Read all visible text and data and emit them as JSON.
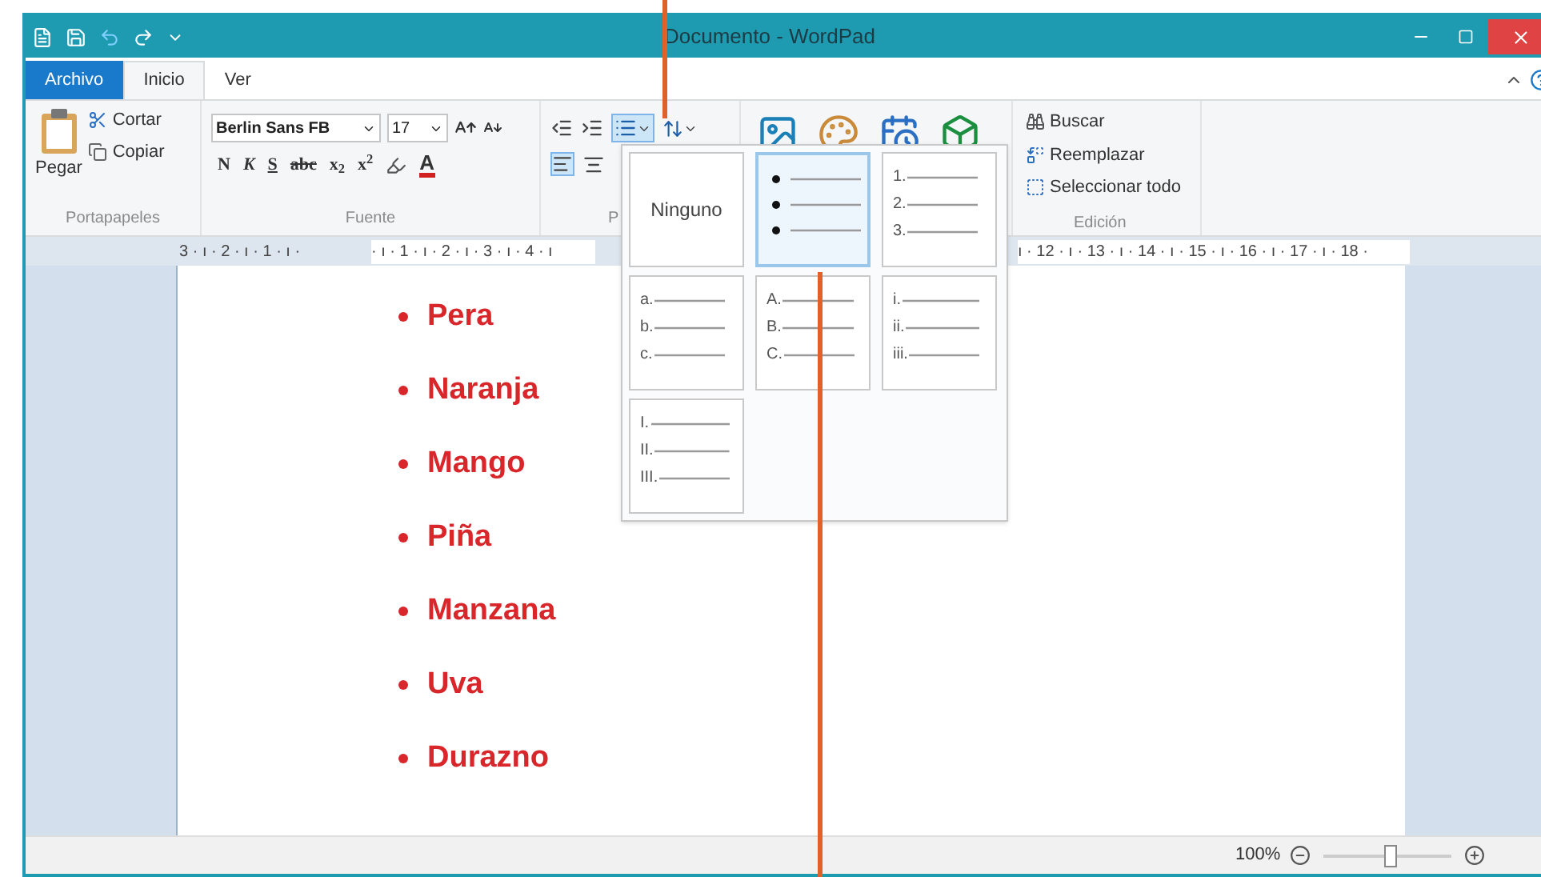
{
  "window": {
    "title": "Documento - WordPad"
  },
  "tabs": [
    {
      "label": "Archivo",
      "kind": "file",
      "selected": false
    },
    {
      "label": "Inicio",
      "kind": "tab",
      "selected": true
    },
    {
      "label": "Ver",
      "kind": "tab",
      "selected": false
    }
  ],
  "clipboard": {
    "paste": "Pegar",
    "cut": "Cortar",
    "copy": "Copiar",
    "label": "Portapapeles"
  },
  "font": {
    "name": "Berlin Sans FB",
    "size": "17",
    "format_buttons": [
      "N",
      "K",
      "S",
      "abc",
      "x$_{2}$",
      "x$^{2}$"
    ],
    "font_color": "A",
    "label": "Fuente"
  },
  "paragraph": {
    "label": "P"
  },
  "editing": {
    "find": "Buscar",
    "replace": "Reemplazar",
    "select_all": "Seleccionar todo",
    "label": "Edición"
  },
  "ruler": {
    "left": "3 · ı · 2 · ı · 1 · ı ·",
    "middle": "· ı · 1 · ı · 2 · ı · 3 · ı · 4 · ı",
    "right": "ı · 12 · ı · 13 · ı · 14 · ı · 15 · ı · 16 · ı · 17 · ı · 18 ·"
  },
  "document": {
    "items": [
      "Pera",
      "Naranja",
      "Mango",
      "Piña",
      "Manzana",
      "Uva",
      "Durazno"
    ]
  },
  "list_menu": {
    "options": [
      {
        "kind": "none",
        "label": "Ninguno",
        "selected": false
      },
      {
        "kind": "bullet",
        "selected": true
      },
      {
        "kind": "marked",
        "markers": [
          "1.",
          "2.",
          "3."
        ],
        "selected": false
      },
      {
        "kind": "marked",
        "markers": [
          "a.",
          "b.",
          "c."
        ],
        "selected": false
      },
      {
        "kind": "marked",
        "markers": [
          "A.",
          "B.",
          "C."
        ],
        "selected": false
      },
      {
        "kind": "marked",
        "markers": [
          "i.",
          "ii.",
          "iii."
        ],
        "selected": false
      },
      {
        "kind": "marked",
        "markers": [
          "I.",
          "II.",
          "III."
        ],
        "selected": false
      }
    ]
  },
  "status_bar": {
    "zoom": "100%",
    "zoom_slider": {
      "level": 0.52
    }
  }
}
